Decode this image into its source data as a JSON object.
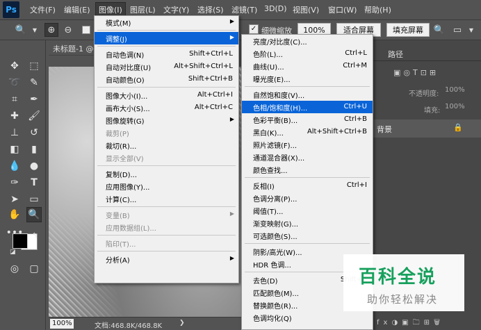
{
  "app": {
    "logo": "Ps"
  },
  "menubar": {
    "items": [
      "文件(F)",
      "编辑(E)",
      "图像(I)",
      "图层(L)",
      "文字(Y)",
      "选择(S)",
      "滤镜(T)",
      "3D(D)",
      "视图(V)",
      "窗口(W)",
      "帮助(H)"
    ],
    "active": "图像(I)"
  },
  "options": {
    "fine_zoom_label": "细微缩放",
    "zoom_value": "100%",
    "fit_screen": "适合屏幕",
    "fill_screen": "填充屏幕"
  },
  "document": {
    "tab_title": "未标题-1 @",
    "zoom": "100%",
    "doc_info": "文档:468.8K/468.8K"
  },
  "panel": {
    "tab_paths": "路径",
    "opacity_label": "不透明度:",
    "opacity_value": "100%",
    "fill_label": "填充:",
    "fill_value": "100%",
    "layer_name": "背景"
  },
  "image_menu": {
    "items": [
      {
        "label": "模式(M)",
        "shortcut": "",
        "submenu": true
      },
      {
        "sep": true
      },
      {
        "label": "调整(J)",
        "shortcut": "",
        "submenu": true,
        "highlight": true
      },
      {
        "sep": true
      },
      {
        "label": "自动色调(N)",
        "shortcut": "Shift+Ctrl+L"
      },
      {
        "label": "自动对比度(U)",
        "shortcut": "Alt+Shift+Ctrl+L"
      },
      {
        "label": "自动颜色(O)",
        "shortcut": "Shift+Ctrl+B"
      },
      {
        "sep": true
      },
      {
        "label": "图像大小(I)...",
        "shortcut": "Alt+Ctrl+I"
      },
      {
        "label": "画布大小(S)...",
        "shortcut": "Alt+Ctrl+C"
      },
      {
        "label": "图像旋转(G)",
        "shortcut": "",
        "submenu": true
      },
      {
        "label": "裁剪(P)",
        "shortcut": "",
        "disabled": true
      },
      {
        "label": "裁切(R)...",
        "shortcut": ""
      },
      {
        "label": "显示全部(V)",
        "shortcut": "",
        "disabled": true
      },
      {
        "sep": true
      },
      {
        "label": "复制(D)...",
        "shortcut": ""
      },
      {
        "label": "应用图像(Y)...",
        "shortcut": ""
      },
      {
        "label": "计算(C)...",
        "shortcut": ""
      },
      {
        "sep": true
      },
      {
        "label": "变量(B)",
        "shortcut": "",
        "submenu": true,
        "disabled": true
      },
      {
        "label": "应用数据组(L)...",
        "shortcut": "",
        "disabled": true
      },
      {
        "sep": true
      },
      {
        "label": "陷印(T)...",
        "shortcut": "",
        "disabled": true
      },
      {
        "sep": true
      },
      {
        "label": "分析(A)",
        "shortcut": "",
        "submenu": true
      }
    ]
  },
  "adjust_menu": {
    "items": [
      {
        "label": "亮度/对比度(C)...",
        "shortcut": ""
      },
      {
        "label": "色阶(L)...",
        "shortcut": "Ctrl+L"
      },
      {
        "label": "曲线(U)...",
        "shortcut": "Ctrl+M"
      },
      {
        "label": "曝光度(E)...",
        "shortcut": ""
      },
      {
        "sep": true
      },
      {
        "label": "自然饱和度(V)...",
        "shortcut": ""
      },
      {
        "label": "色相/饱和度(H)...",
        "shortcut": "Ctrl+U",
        "highlight": true
      },
      {
        "label": "色彩平衡(B)...",
        "shortcut": "Ctrl+B"
      },
      {
        "label": "黑白(K)...",
        "shortcut": "Alt+Shift+Ctrl+B"
      },
      {
        "label": "照片滤镜(F)...",
        "shortcut": ""
      },
      {
        "label": "通道混合器(X)...",
        "shortcut": ""
      },
      {
        "label": "颜色查找...",
        "shortcut": ""
      },
      {
        "sep": true
      },
      {
        "label": "反相(I)",
        "shortcut": "Ctrl+I"
      },
      {
        "label": "色调分离(P)...",
        "shortcut": ""
      },
      {
        "label": "阈值(T)...",
        "shortcut": ""
      },
      {
        "label": "渐变映射(G)...",
        "shortcut": ""
      },
      {
        "label": "可选颜色(S)...",
        "shortcut": ""
      },
      {
        "sep": true
      },
      {
        "label": "阴影/高光(W)...",
        "shortcut": ""
      },
      {
        "label": "HDR 色调...",
        "shortcut": ""
      },
      {
        "sep": true
      },
      {
        "label": "去色(D)",
        "shortcut": "Shift+C"
      },
      {
        "label": "匹配颜色(M)...",
        "shortcut": ""
      },
      {
        "label": "替换颜色(R)...",
        "shortcut": ""
      },
      {
        "label": "色调均化(Q)",
        "shortcut": ""
      }
    ]
  },
  "watermark": {
    "title": "百科全说",
    "subtitle": "助你轻松解决"
  }
}
